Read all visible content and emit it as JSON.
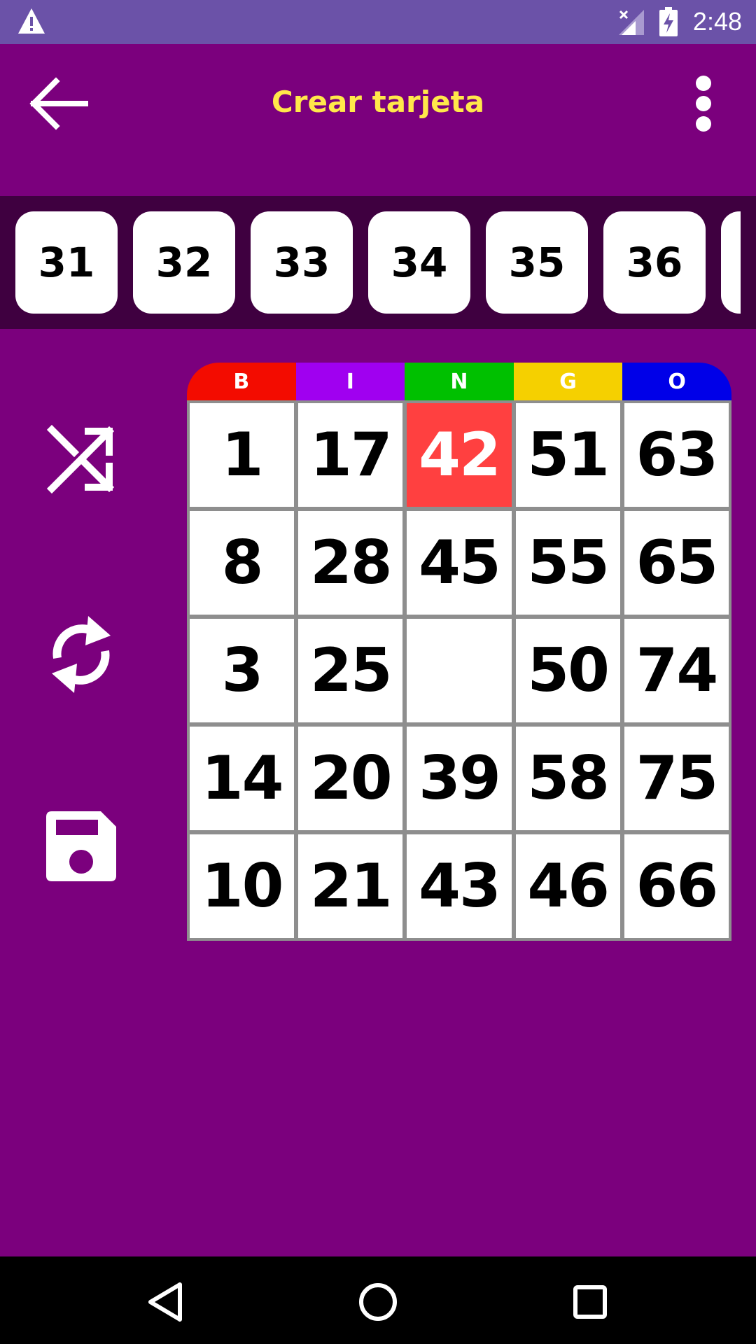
{
  "status_bar": {
    "time": "2:48",
    "icons": [
      "warning-icon",
      "signal-off-icon",
      "battery-charging-icon"
    ]
  },
  "app_bar": {
    "title": "Crear tarjeta",
    "icons": [
      "arrow-back-icon",
      "more-vertical-icon"
    ]
  },
  "number_strip": {
    "numbers": [
      "31",
      "32",
      "33",
      "34",
      "35",
      "36"
    ]
  },
  "tools": [
    "shuffle-icon",
    "refresh-icon",
    "save-icon"
  ],
  "card": {
    "header": [
      "B",
      "I",
      "N",
      "G",
      "O"
    ],
    "header_colors": [
      "#f30c00",
      "#a000f0",
      "#00c000",
      "#f5d000",
      "#0000e8"
    ],
    "rows": [
      [
        "1",
        "17",
        "42",
        "51",
        "63"
      ],
      [
        "8",
        "28",
        "45",
        "55",
        "65"
      ],
      [
        "3",
        "25",
        "",
        "50",
        "74"
      ],
      [
        "14",
        "20",
        "39",
        "58",
        "75"
      ],
      [
        "10",
        "21",
        "43",
        "46",
        "66"
      ]
    ],
    "marked_color": "#ff4040"
  },
  "nav_bar": {
    "icons": [
      "back-triangle-icon",
      "home-circle-icon",
      "recents-square-icon"
    ]
  }
}
